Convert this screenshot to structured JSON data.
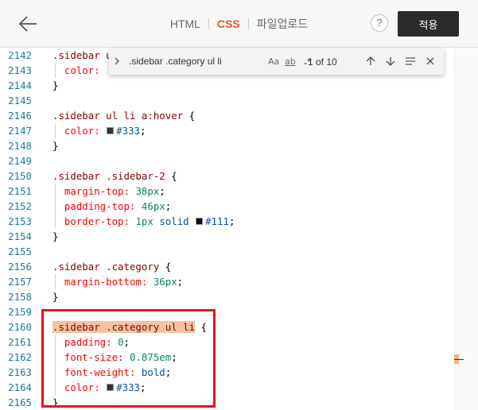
{
  "header": {
    "tabs": [
      {
        "label": "HTML",
        "active": false
      },
      {
        "label": "CSS",
        "active": true
      },
      {
        "label": "파일업로드",
        "active": false
      }
    ],
    "help_label": "?",
    "apply_label": "적용",
    "accent_color": "#e8542c"
  },
  "find": {
    "query": ".sidebar .category ul li",
    "match_case": "Aa",
    "whole_word": "ab",
    "regex": ".*",
    "count": "1 of 10"
  },
  "editor": {
    "lines": [
      {
        "n": "2142",
        "code": ".sidebar u"
      },
      {
        "n": "2143",
        "code": "  color: "
      },
      {
        "n": "2144",
        "code": "}"
      },
      {
        "n": "2145",
        "code": ""
      },
      {
        "n": "2146",
        "code": ".sidebar ul li a:hover {"
      },
      {
        "n": "2147",
        "code": "  color: #333;"
      },
      {
        "n": "2148",
        "code": "}"
      },
      {
        "n": "2149",
        "code": ""
      },
      {
        "n": "2150",
        "code": ".sidebar .sidebar-2 {"
      },
      {
        "n": "2151",
        "code": "  margin-top: 38px;"
      },
      {
        "n": "2152",
        "code": "  padding-top: 46px;"
      },
      {
        "n": "2153",
        "code": "  border-top: 1px solid #111;"
      },
      {
        "n": "2154",
        "code": "}"
      },
      {
        "n": "2155",
        "code": ""
      },
      {
        "n": "2156",
        "code": ".sidebar .category {"
      },
      {
        "n": "2157",
        "code": "  margin-bottom: 36px;"
      },
      {
        "n": "2158",
        "code": "}"
      },
      {
        "n": "2159",
        "code": ""
      },
      {
        "n": "2160",
        "code": ".sidebar .category ul li {"
      },
      {
        "n": "2161",
        "code": "  padding: 0;"
      },
      {
        "n": "2162",
        "code": "  font-size: 0.875em;"
      },
      {
        "n": "2163",
        "code": "  font-weight: bold;"
      },
      {
        "n": "2164",
        "code": "  color: #333;"
      },
      {
        "n": "2165",
        "code": "}"
      }
    ],
    "swatch_colors": {
      "#333": "#333333",
      "#111": "#111111"
    },
    "highlight_color": "#e0141e"
  }
}
